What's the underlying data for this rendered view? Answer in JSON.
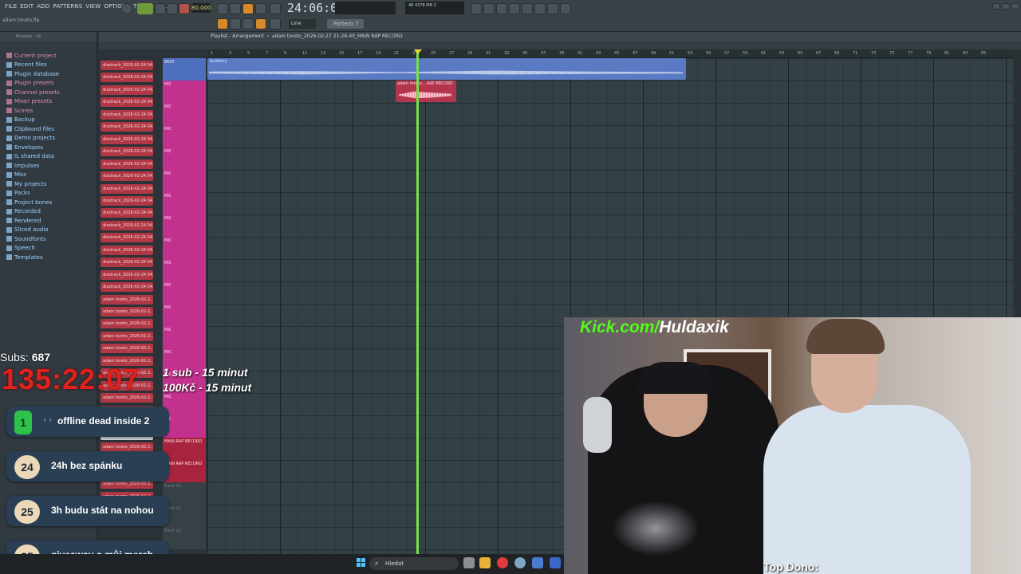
{
  "menu": [
    "FILE",
    "EDIT",
    "ADD",
    "PATTERNS",
    "VIEW",
    "OPTIONS",
    "TOOLS",
    "HELP"
  ],
  "project_file": "adam toreto.flp",
  "tempo": "80.000",
  "song_time": "24:06:04",
  "pattern": "Pattern 7",
  "snap": "Line",
  "cpu": {
    "mem": "4378 MB",
    "value": "46",
    "voices": "2"
  },
  "browser": {
    "header": "Browser - All",
    "items": [
      {
        "label": "Current project",
        "color": "#e58aab"
      },
      {
        "label": "Recent files",
        "color": "#9fd2ff"
      },
      {
        "label": "Plugin database",
        "color": "#9fd2ff"
      },
      {
        "label": "Plugin presets",
        "color": "#e58aab"
      },
      {
        "label": "Channel presets",
        "color": "#e58aab"
      },
      {
        "label": "Mixer presets",
        "color": "#e58aab"
      },
      {
        "label": "Scores",
        "color": "#e58aab"
      },
      {
        "label": "Backup",
        "color": "#9fd2ff"
      },
      {
        "label": "Clipboard files",
        "color": "#9fd2ff"
      },
      {
        "label": "Demo projects",
        "color": "#9fd2ff"
      },
      {
        "label": "Envelopes",
        "color": "#9fd2ff"
      },
      {
        "label": "IL shared data",
        "color": "#9fd2ff"
      },
      {
        "label": "Impulses",
        "color": "#9fd2ff"
      },
      {
        "label": "Misc",
        "color": "#9fd2ff"
      },
      {
        "label": "My projects",
        "color": "#9fd2ff"
      },
      {
        "label": "Packs",
        "color": "#9fd2ff"
      },
      {
        "label": "Project bones",
        "color": "#9fd2ff"
      },
      {
        "label": "Recorded",
        "color": "#9fd2ff"
      },
      {
        "label": "Rendered",
        "color": "#9fd2ff"
      },
      {
        "label": "Sliced audio",
        "color": "#9fd2ff"
      },
      {
        "label": "Soundfonts",
        "color": "#9fd2ff"
      },
      {
        "label": "Speech",
        "color": "#9fd2ff"
      },
      {
        "label": "Templates",
        "color": "#9fd2ff"
      }
    ]
  },
  "channels": [
    "disstrack_2026-02-24 04..",
    "disstrack_2026-02-24 04..",
    "disstrack_2026-02-24 04..",
    "disstrack_2026-02-24 04..",
    "disstrack_2026-02-24 04..",
    "disstrack_2026-02-24 04..",
    "disstrack_2026-02-24 04..",
    "disstrack_2026-02-24 04..",
    "disstrack_2026-02-24 04..",
    "disstrack_2026-02-24 04..",
    "disstrack_2026-02-24 04..",
    "disstrack_2026-02-24 04..",
    "disstrack_2026-02-24 04..",
    "disstrack_2026-02-24 04..",
    "disstrack_2026-02-24 04..",
    "disstrack_2026-02-24 04..",
    "disstrack_2026-02-24 04..",
    "disstrack_2026-02-24 04..",
    "disstrack_2026-02-24 04..",
    "adam toreto_2026-02-2..",
    "adam toreto_2026-02-2..",
    "adam toreto_2026-02-2..",
    "adam toreto_2026-02-2..",
    "adam toreto_2026-02-2..",
    "adam toreto_2026-02-2..",
    "adam toreto_2026-02-2..",
    "adam toreto_2026-02-2..",
    "adam toreto_2026-02-2..",
    "adam toreto_2026-02-2..",
    "adam toreto_2026-02-2..",
    "burberry",
    "adam toreto_2026-02-2..",
    "adam toreto_2026-02-2..",
    "adam toreto_2026-02-2..",
    "adam toreto_2026-02-2..",
    "adam toreto_2026-02-2..",
    "adam toreto_2026-02-2.."
  ],
  "playlist": {
    "title": "Playlist - Arrangement",
    "breadcrumb": "adam toreto_2026-02-27 21-26-40_MAIN RAP RECORD",
    "ruler": [
      "1",
      "3",
      "5",
      "7",
      "9",
      "11",
      "13",
      "15",
      "17",
      "19",
      "21",
      "23",
      "25",
      "27",
      "29",
      "31",
      "33",
      "35",
      "37",
      "39",
      "41",
      "43",
      "45",
      "47",
      "49",
      "51",
      "53",
      "55",
      "57",
      "59",
      "61",
      "63",
      "65",
      "67",
      "69",
      "71",
      "73",
      "75",
      "77",
      "79",
      "81",
      "83",
      "85"
    ],
    "tracks": [
      {
        "label": "BEAT",
        "kind": "beat"
      },
      {
        "label": "MIC",
        "kind": "mic"
      },
      {
        "label": "MIC",
        "kind": "mic"
      },
      {
        "label": "MIC",
        "kind": "mic"
      },
      {
        "label": "MIC",
        "kind": "mic"
      },
      {
        "label": "MIC",
        "kind": "mic"
      },
      {
        "label": "MIC",
        "kind": "mic"
      },
      {
        "label": "MIC",
        "kind": "mic"
      },
      {
        "label": "MIC",
        "kind": "mic"
      },
      {
        "label": "MIC",
        "kind": "mic"
      },
      {
        "label": "MIC",
        "kind": "mic"
      },
      {
        "label": "MIC",
        "kind": "mic"
      },
      {
        "label": "MIC",
        "kind": "mic"
      },
      {
        "label": "MIC",
        "kind": "mic"
      },
      {
        "label": "MIC",
        "kind": "mic"
      },
      {
        "label": "MIC",
        "kind": "mic"
      },
      {
        "label": "MIC",
        "kind": "mic"
      },
      {
        "label": "MAIN RAP RECORD",
        "kind": "main"
      },
      {
        "label": "MAIN RAP RECORD",
        "kind": "main"
      },
      {
        "label": "Track 20",
        "kind": "gray"
      },
      {
        "label": "Track 21",
        "kind": "gray"
      },
      {
        "label": "Track 22",
        "kind": "gray"
      }
    ],
    "clip_beat": "burberry",
    "clip_rap": "adam toreto... RAP RECORD"
  },
  "overlay": {
    "subs_label": "Subs:",
    "subs_value": "687",
    "timer": "135:22:07",
    "rule1": "1 sub - 15 minut",
    "rule2": "100Kč - 15 minut",
    "goals": [
      {
        "num": "1",
        "text": "offline dead inside 2",
        "color": "#2fc24a"
      },
      {
        "num": "24",
        "text": "24h bez spánku",
        "color": "#ead8b8"
      },
      {
        "num": "25",
        "text": "3h budu stát na nohou",
        "color": "#ead8b8"
      },
      {
        "num": "35",
        "text": "giveaway o můj merch",
        "color": "#ead8b8"
      }
    ]
  },
  "webcam": {
    "logo_green": "Kick.com/",
    "logo_white": "Huldaxik",
    "top_dono": "Top Dono:"
  },
  "taskbar": {
    "search": "Hledat"
  }
}
